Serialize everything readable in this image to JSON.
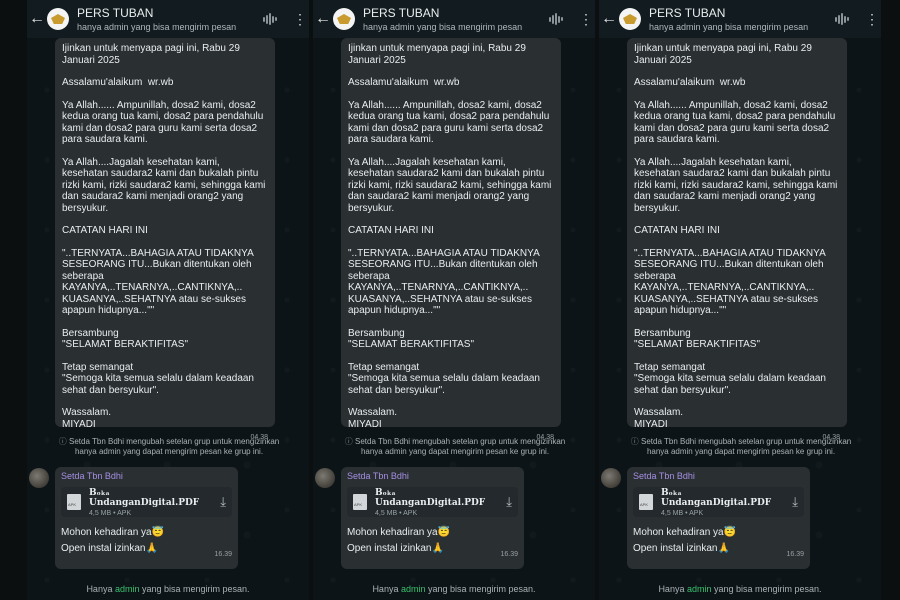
{
  "header": {
    "title": "PERS TUBAN",
    "subtitle": "hanya admin yang bisa mengirim pesan"
  },
  "message": {
    "paragraphs": [
      "Ijinkan untuk menyapa pagi ini, Rabu 29 Januari 2025",
      "Assalamu'alaikum  wr.wb",
      "Ya Allah...... Ampunillah, dosa2 kami, dosa2 kedua orang tua kami, dosa2 para pendahulu kami dan dosa2 para guru kami serta dosa2 para saudara kami.",
      "Ya Allah....Jagalah kesehatan kami, kesehatan saudara2 kami dan bukalah pintu rizki kami, rizki saudara2 kami, sehingga kami dan saudara2 kami menjadi orang2 yang bersyukur.",
      "CATATAN HARI INI",
      "\"..TERNYATA...BAHAGIA ATAU TIDAKNYA SESEORANG ITU...Bukan ditentukan oleh seberapa KAYANYA,..TENARNYA,..CANTIKNYA,.. KUASANYA,..SEHATNYA atau se-sukses apapun hidupnya...\"\"",
      "Bersambung\n\"SELAMAT BERAKTIFITAS\"",
      "Tetap semangat\n\"Semoga kita semua selalu dalam keadaan sehat dan bersyukur\".",
      "Wassalam.\nMIYADI"
    ],
    "time": "04.38"
  },
  "system_notice": "Setda Tbn Bdhi mengubah setelan grup untuk mengizinkan hanya admin yang dapat mengirim pesan ke grup ini.",
  "message2": {
    "sender": "Setda Tbn Bdhi",
    "document": {
      "name": "Bₒₖₐ UndanganDigital.PDF",
      "meta": "4,5 MB • APK",
      "icon": "document-icon"
    },
    "line1": "Mohon kehadiran ya😇",
    "line2": "Open instal izinkan🙏",
    "time": "16.39"
  },
  "footer": {
    "prefix": "Hanya ",
    "admin": "admin",
    "suffix": " yang bisa mengirim pesan."
  },
  "icons": {
    "back": "arrow-left-icon",
    "voice": "waveform-icon",
    "menu": "more-vert-icon",
    "download": "download-icon",
    "lock": "info-icon"
  },
  "colors": {
    "background": "#0d1418",
    "bubble": "#2a2f32",
    "sender": "#a58fe3",
    "admin": "#39c06d"
  }
}
